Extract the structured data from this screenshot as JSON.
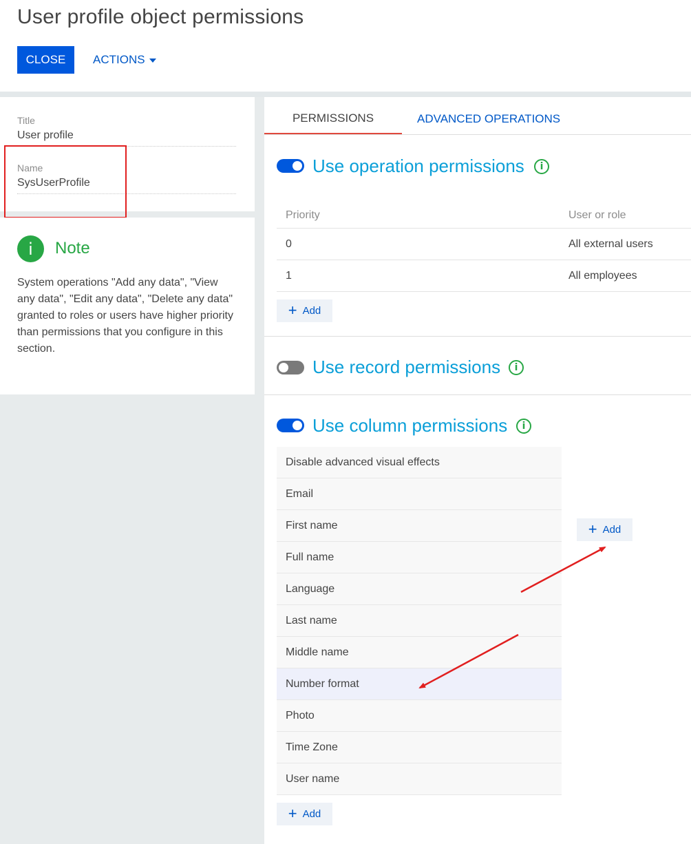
{
  "header": {
    "title": "User profile object permissions",
    "close_label": "CLOSE",
    "actions_label": "ACTIONS"
  },
  "details": {
    "title_caption": "Title",
    "title_value": "User profile",
    "name_caption": "Name",
    "name_value": "SysUserProfile"
  },
  "note": {
    "icon": "i",
    "title": "Note",
    "text": "System operations \"Add any data\", \"View any data\", \"Edit any data\", \"Delete any data\" granted to roles or users have higher priority than permissions that you configure in this section."
  },
  "tabs": [
    {
      "label": "PERMISSIONS",
      "active": true
    },
    {
      "label": "ADVANCED OPERATIONS",
      "active": false
    }
  ],
  "operation_permissions": {
    "title": "Use operation permissions",
    "enabled": true,
    "info_icon": "i",
    "columns": {
      "priority": "Priority",
      "user_or_role": "User or role"
    },
    "rows": [
      {
        "priority": "0",
        "user_or_role": "All external users"
      },
      {
        "priority": "1",
        "user_or_role": "All employees"
      }
    ],
    "add_label": "Add"
  },
  "record_permissions": {
    "title": "Use record permissions",
    "enabled": false,
    "info_icon": "i"
  },
  "column_permissions": {
    "title": "Use column permissions",
    "enabled": true,
    "info_icon": "i",
    "columns": [
      "Disable advanced visual effects",
      "Email",
      "First name",
      "Full name",
      "Language",
      "Last name",
      "Middle name",
      "Number format",
      "Photo",
      "Time Zone",
      "User name"
    ],
    "highlighted": "Number format",
    "add_label": "Add",
    "side_add_label": "Add"
  },
  "colors": {
    "primary": "#0058dd",
    "link": "#0058c7",
    "section_title": "#0b9fd8",
    "success": "#28a745",
    "annotation": "#e11f1f"
  }
}
